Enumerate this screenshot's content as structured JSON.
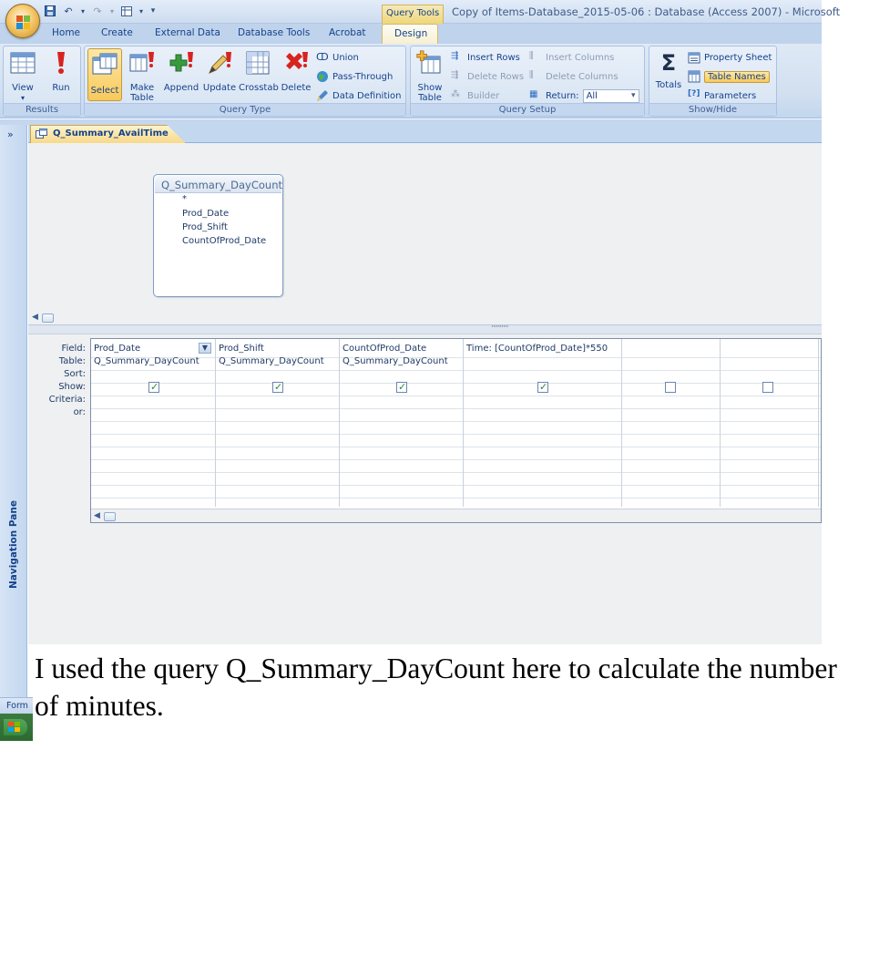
{
  "title_bar": {
    "context_tab_group": "Query Tools",
    "window_title": "Copy of Items-Database_2015-05-06 : Database (Access 2007) - Microsoft"
  },
  "ribbon_tabs": [
    "Home",
    "Create",
    "External Data",
    "Database Tools",
    "Acrobat"
  ],
  "active_tab": "Design",
  "ribbon": {
    "results": {
      "label": "Results",
      "view": "View",
      "run": "Run"
    },
    "query_type": {
      "label": "Query Type",
      "select": "Select",
      "make_table_1": "Make",
      "make_table_2": "Table",
      "append": "Append",
      "update": "Update",
      "crosstab": "Crosstab",
      "delete": "Delete",
      "union": "Union",
      "pass_through": "Pass-Through",
      "data_definition": "Data Definition"
    },
    "query_setup": {
      "label": "Query Setup",
      "show_table_1": "Show",
      "show_table_2": "Table",
      "insert_rows": "Insert Rows",
      "delete_rows": "Delete Rows",
      "builder": "Builder",
      "insert_columns": "Insert Columns",
      "delete_columns": "Delete Columns",
      "return_label": "Return:",
      "return_value": "All"
    },
    "show_hide": {
      "label": "Show/Hide",
      "totals": "Totals",
      "property_sheet": "Property Sheet",
      "table_names": "Table Names",
      "parameters": "Parameters"
    }
  },
  "nav_pane": {
    "toggle": "»",
    "label": "Navigation Pane"
  },
  "document_tab": "Q_Summary_AvailTime",
  "table_box": {
    "title": "Q_Summary_DayCount",
    "fields": [
      "*",
      "Prod_Date",
      "Prod_Shift",
      "CountOfProd_Date"
    ]
  },
  "qbe": {
    "row_labels": [
      "Field:",
      "Table:",
      "Sort:",
      "Show:",
      "Criteria:",
      "or:"
    ],
    "columns": [
      {
        "field": "Prod_Date",
        "table": "Q_Summary_DayCount",
        "show": true
      },
      {
        "field": "Prod_Shift",
        "table": "Q_Summary_DayCount",
        "show": true
      },
      {
        "field": "CountOfProd_Date",
        "table": "Q_Summary_DayCount",
        "show": true
      },
      {
        "field": "Time: [CountOfProd_Date]*550",
        "table": "",
        "show": true
      },
      {
        "field": "",
        "table": "",
        "show": false
      },
      {
        "field": "",
        "table": "",
        "show": false
      }
    ]
  },
  "status_bar": "Form",
  "caption": "I used the query Q_Summary_DayCount here to calculate the number of minutes.",
  "colors": {
    "ribbon_blue": "#d1dff0",
    "accent_text": "#15428b",
    "selected_gold": "#f8c95b"
  }
}
